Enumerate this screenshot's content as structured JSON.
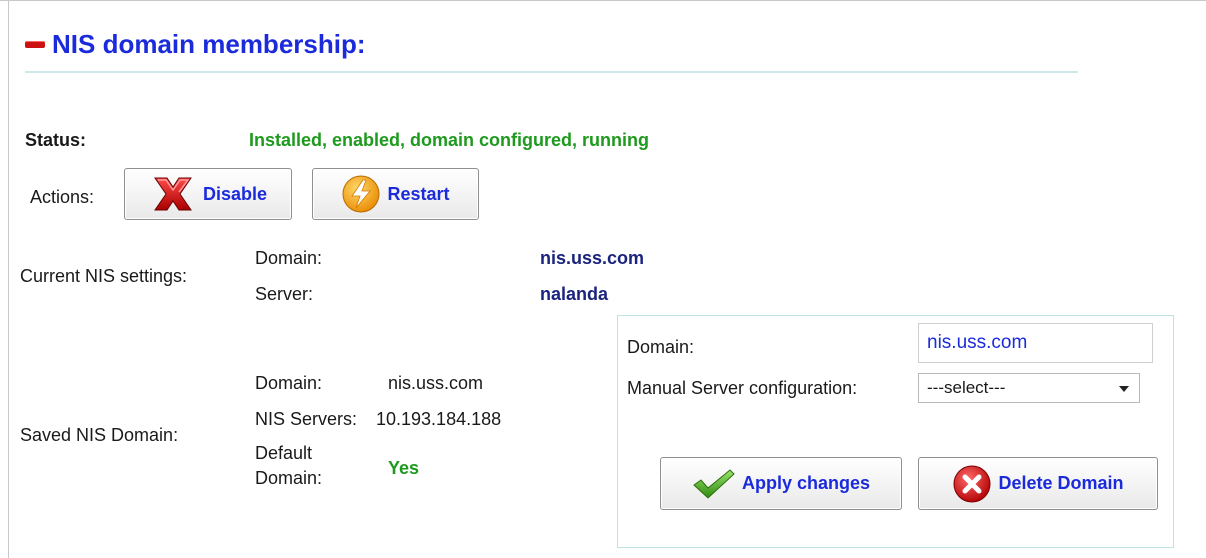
{
  "header": {
    "title": "NIS domain membership:"
  },
  "status": {
    "label": "Status:",
    "value": "Installed, enabled, domain configured, running"
  },
  "actions": {
    "label": "Actions:",
    "disable_label": "Disable",
    "restart_label": "Restart"
  },
  "current": {
    "label": "Current NIS settings:",
    "domain_label": "Domain:",
    "domain_value": "nis.uss.com",
    "server_label": "Server:",
    "server_value": "nalanda"
  },
  "saved": {
    "label": "Saved NIS Domain:",
    "domain_label": "Domain:",
    "domain_value": "nis.uss.com",
    "servers_label": "NIS Servers:",
    "servers_value": "10.193.184.188",
    "default_label": "Default Domain:",
    "default_value": "Yes"
  },
  "edit": {
    "domain_label": "Domain:",
    "domain_value": "nis.uss.com",
    "manual_label": "Manual Server configuration:",
    "manual_selected": "---select---",
    "apply_label": "Apply changes",
    "delete_label": "Delete Domain"
  },
  "colors": {
    "title": "#1b2bdc",
    "ok_green": "#1e9a1e",
    "value_navy": "#1a237e",
    "collapse_red": "#cc1111"
  },
  "icons": [
    "collapse-icon",
    "disable-x-icon",
    "restart-bolt-icon",
    "checkmark-icon",
    "delete-x-icon",
    "chevron-down-icon"
  ]
}
